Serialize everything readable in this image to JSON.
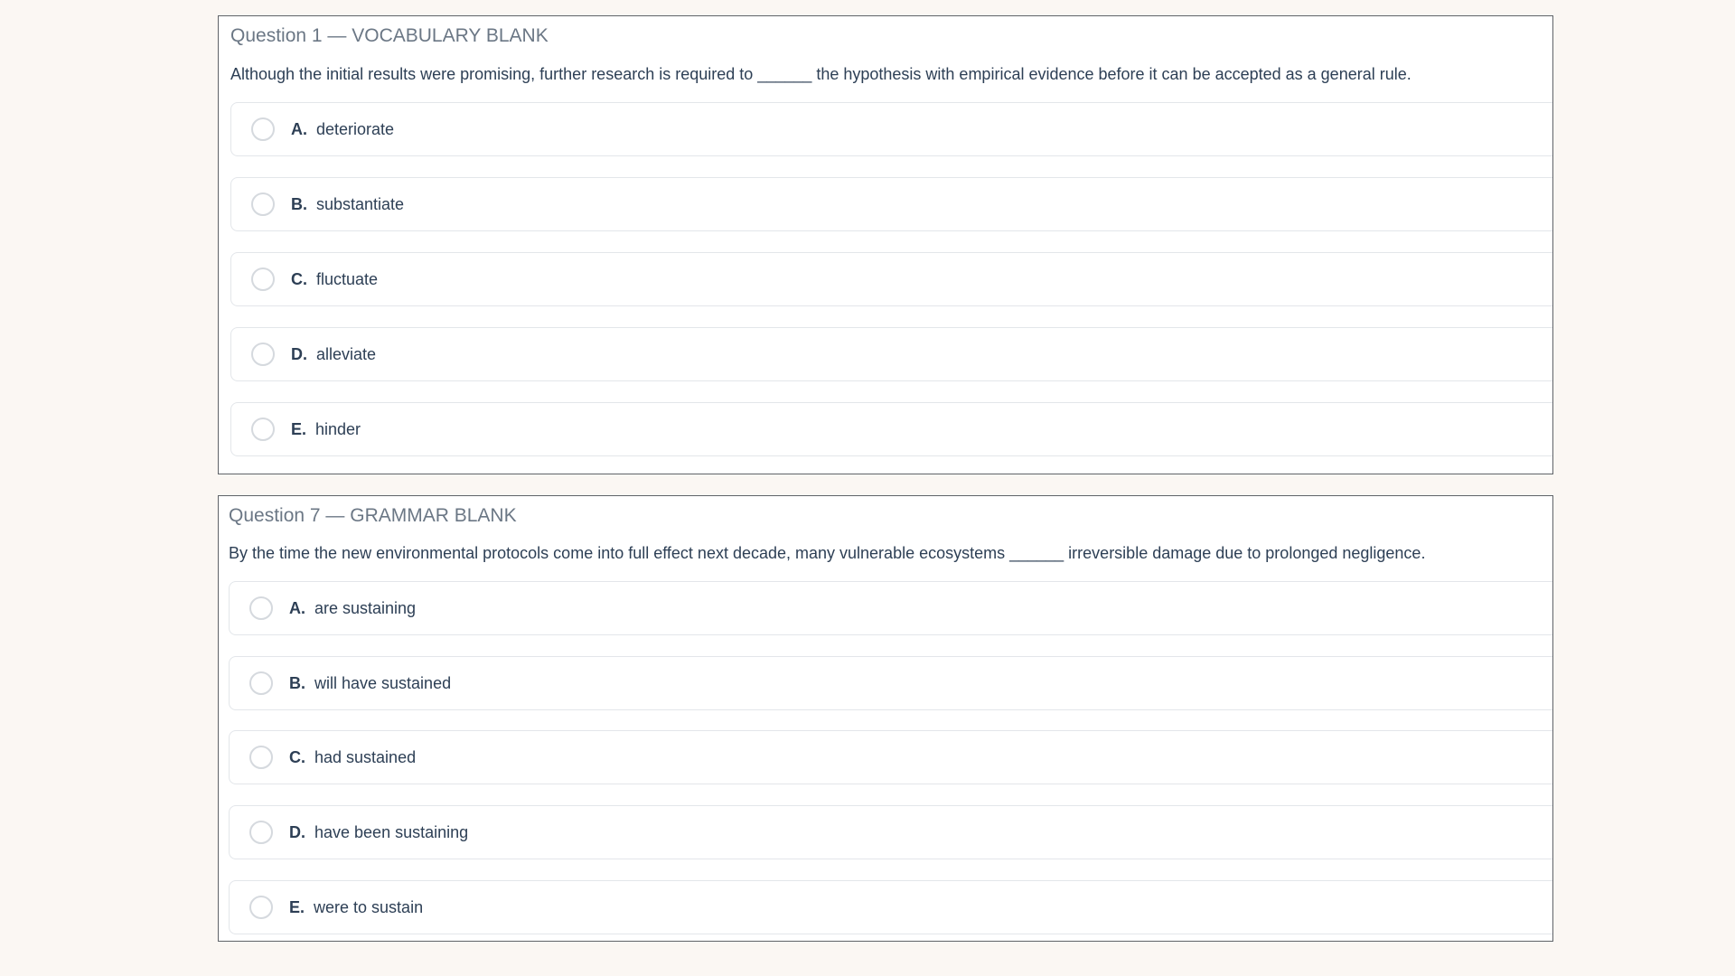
{
  "questions": [
    {
      "heading": "Question 1 — VOCABULARY BLANK",
      "prompt": "Although the initial results were promising, further research is required to ______ the hypothesis with empirical evidence before it can be accepted as a general rule.",
      "options": [
        {
          "letter": "A.",
          "text": "deteriorate"
        },
        {
          "letter": "B.",
          "text": "substantiate"
        },
        {
          "letter": "C.",
          "text": "fluctuate"
        },
        {
          "letter": "D.",
          "text": "alleviate"
        },
        {
          "letter": "E.",
          "text": "hinder"
        }
      ]
    },
    {
      "heading": "Question 7 — GRAMMAR BLANK",
      "prompt": "By the time the new environmental protocols come into full effect next decade, many vulnerable ecosystems ______ irreversible damage due to prolonged negligence.",
      "options": [
        {
          "letter": "A.",
          "text": "are sustaining"
        },
        {
          "letter": "B.",
          "text": "will have sustained"
        },
        {
          "letter": "C.",
          "text": "had sustained"
        },
        {
          "letter": "D.",
          "text": "have been sustaining"
        },
        {
          "letter": "E.",
          "text": "were to sustain"
        }
      ]
    }
  ]
}
